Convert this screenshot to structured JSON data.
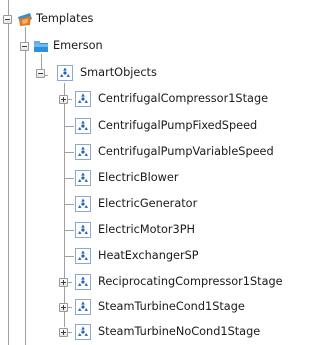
{
  "tree": {
    "root": {
      "label": "Templates",
      "icon": "templates-icon",
      "expanded": true
    },
    "folder": {
      "label": "Emerson",
      "icon": "folder-icon",
      "expanded": true
    },
    "group": {
      "label": "SmartObjects",
      "icon": "smart-object-icon",
      "expanded": true
    },
    "items": [
      {
        "label": "CentrifugalCompressor1Stage",
        "expandable": true
      },
      {
        "label": "CentrifugalPumpFixedSpeed",
        "expandable": false
      },
      {
        "label": "CentrifugalPumpVariableSpeed",
        "expandable": false
      },
      {
        "label": "ElectricBlower",
        "expandable": false
      },
      {
        "label": "ElectricGenerator",
        "expandable": false
      },
      {
        "label": "ElectricMotor3PH",
        "expandable": false
      },
      {
        "label": "HeatExchangerSP",
        "expandable": false
      },
      {
        "label": "ReciprocatingCompressor1Stage",
        "expandable": true
      },
      {
        "label": "SteamTurbineCond1Stage",
        "expandable": true
      },
      {
        "label": "SteamTurbineNoCond1Stage",
        "expandable": true
      }
    ]
  },
  "colors": {
    "tree_line": "#a0a0a0",
    "smart_object_blue": "#1f5fbf",
    "templates_orange": "#e07820",
    "folder_blue": "#2f8fd8"
  }
}
